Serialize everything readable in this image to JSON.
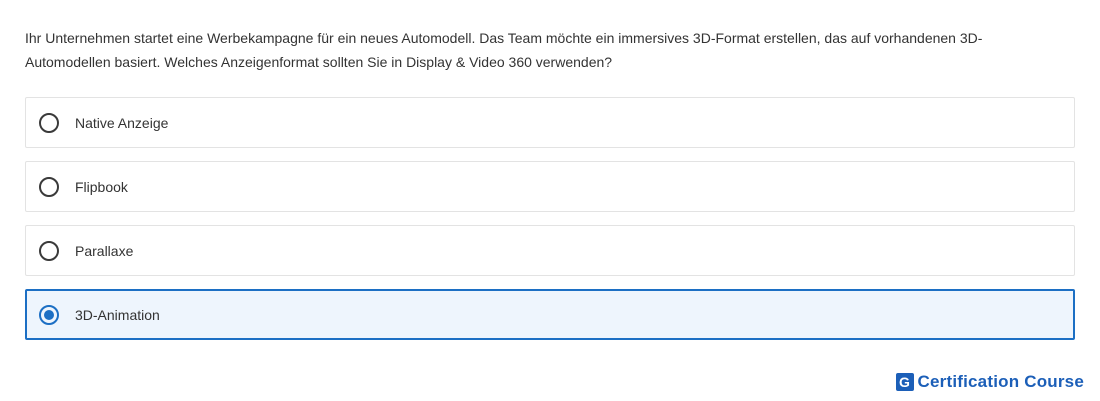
{
  "question": {
    "text": "Ihr Unternehmen startet eine Werbekampagne für ein neues Automodell. Das Team möchte ein immersives 3D-Format erstellen, das auf vorhandenen 3D-Automodellen basiert. Welches Anzeigenformat sollten Sie in Display & Video 360 verwenden?"
  },
  "options": [
    {
      "label": "Native Anzeige",
      "selected": false
    },
    {
      "label": "Flipbook",
      "selected": false
    },
    {
      "label": "Parallaxe",
      "selected": false
    },
    {
      "label": "3D-Animation",
      "selected": true
    }
  ],
  "brand": {
    "logo_letter": "G",
    "name": "Certification Course",
    "color": "#1c5fb8"
  },
  "colors": {
    "accent": "#1c6fc4",
    "selected_background": "#eef5fd"
  }
}
